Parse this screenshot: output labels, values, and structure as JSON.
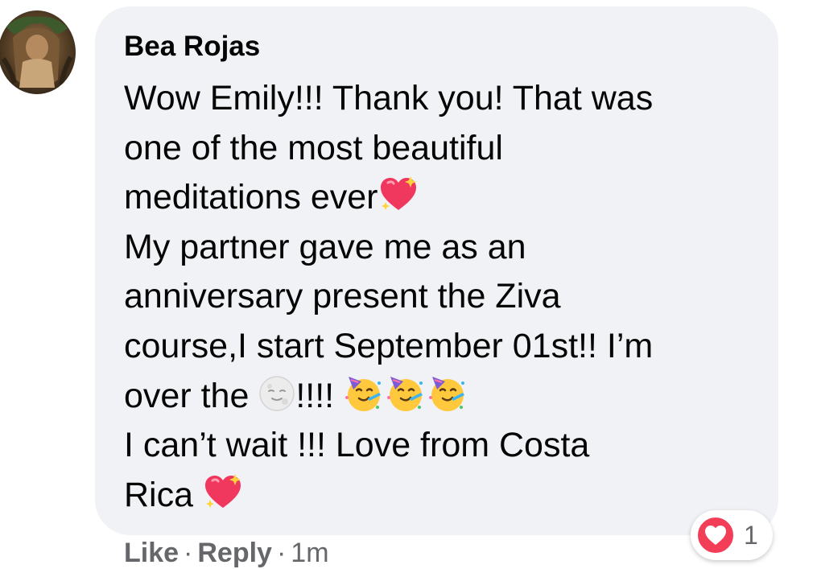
{
  "comment": {
    "author": "Bea Rojas",
    "lines": [
      "Wow Emily!!! Thank you! That was",
      "one of the most beautiful",
      "meditations ever",
      "My partner gave me as an",
      "anniversary present the Ziva",
      "course,I start September 01st!! I’m",
      "over the ",
      "!!!! ",
      "I can’t wait !!! Love from Costa",
      "Rica "
    ],
    "emojis": {
      "sparkling_heart": "sparkling-heart-emoji",
      "full_moon_face": "full-moon-face-emoji",
      "partying_face": "partying-face-emoji"
    },
    "reactions": {
      "icon": "love-reaction-icon",
      "count": "1",
      "color": "#f33e58"
    }
  },
  "actions": {
    "like": "Like",
    "separator": "·",
    "reply": "Reply",
    "time": "1m"
  },
  "colors": {
    "bubble": "#f0f2f5",
    "text": "#050505",
    "secondary": "#65676b"
  }
}
